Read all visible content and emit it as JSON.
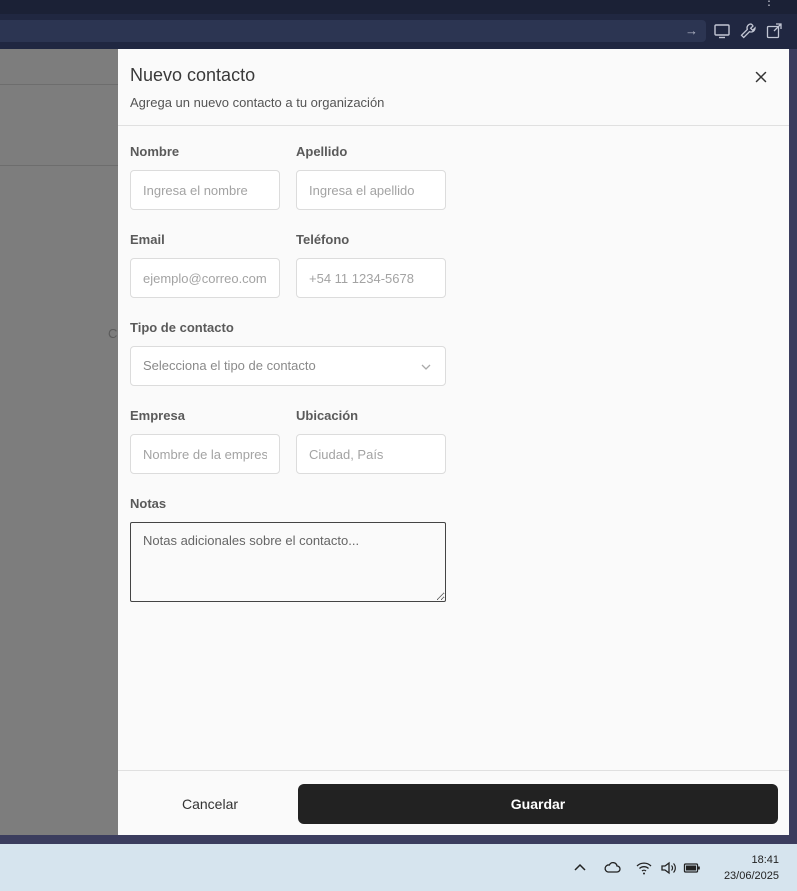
{
  "browser": {
    "toolbar_icons": [
      "cast-icon",
      "wrench-icon",
      "open-external-icon"
    ],
    "go_icon": "arrow-right-icon",
    "menu_icon": "more-vert-icon"
  },
  "background": {
    "fragment_text": "C"
  },
  "dialog": {
    "title": "Nuevo contacto",
    "subtitle": "Agrega un nuevo contacto a tu organización",
    "close_icon": "close-icon",
    "fields": {
      "nombre": {
        "label": "Nombre",
        "placeholder": "Ingresa el nombre",
        "value": ""
      },
      "apellido": {
        "label": "Apellido",
        "placeholder": "Ingresa el apellido",
        "value": ""
      },
      "email": {
        "label": "Email",
        "placeholder": "ejemplo@correo.com",
        "value": ""
      },
      "telefono": {
        "label": "Teléfono",
        "placeholder": "+54 11 1234-5678",
        "value": ""
      },
      "tipo": {
        "label": "Tipo de contacto",
        "placeholder": "Selecciona el tipo de contacto"
      },
      "empresa": {
        "label": "Empresa",
        "placeholder": "Nombre de la empresa",
        "value": ""
      },
      "ubicacion": {
        "label": "Ubicación",
        "placeholder": "Ciudad, País",
        "value": ""
      },
      "notas": {
        "label": "Notas",
        "placeholder": "Notas adicionales sobre el contacto...",
        "value": ""
      }
    },
    "cancel_label": "Cancelar",
    "save_label": "Guardar"
  },
  "taskbar": {
    "tray_icons": [
      "chevron-up-icon",
      "cloud-icon",
      "wifi-icon",
      "volume-icon",
      "battery-icon"
    ],
    "time": "18:41",
    "date": "23/06/2025"
  },
  "colors": {
    "primary_button": "#222222",
    "overlay": "#7d7d7d",
    "taskbar": "#d6e4ee"
  }
}
